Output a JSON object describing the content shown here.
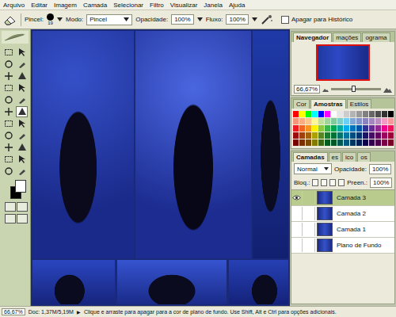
{
  "menu": [
    "Arquivo",
    "Editar",
    "Imagem",
    "Camada",
    "Selecionar",
    "Filtro",
    "Visualizar",
    "Janela",
    "Ajuda"
  ],
  "options": {
    "brush_label": "Pincel:",
    "brush_size": "19",
    "mode_label": "Modo:",
    "mode": "Pincel",
    "opacity_label": "Opacidade:",
    "opacity": "100%",
    "flow_label": "Fluxo:",
    "flow": "100%",
    "history_label": "Apagar para Histórico",
    "history_checked": false
  },
  "tools": [
    {
      "selected": false
    },
    {
      "selected": false
    },
    {
      "selected": false
    },
    {
      "selected": false
    },
    {
      "selected": false
    },
    {
      "selected": false
    },
    {
      "selected": false
    },
    {
      "selected": false
    },
    {
      "selected": false
    },
    {
      "selected": false
    },
    {
      "selected": false
    },
    {
      "selected": true
    },
    {
      "selected": false
    },
    {
      "selected": false
    },
    {
      "selected": false
    },
    {
      "selected": false
    },
    {
      "selected": false
    },
    {
      "selected": false
    },
    {
      "selected": false
    },
    {
      "selected": false
    },
    {
      "selected": false
    },
    {
      "selected": false
    }
  ],
  "colors": {
    "foreground": "#ffffff",
    "background": "#000000"
  },
  "navigator": {
    "tabs": [
      {
        "label": "Navegador",
        "selected": true
      },
      {
        "label": "mações",
        "selected": false
      },
      {
        "label": "ograma",
        "selected": false
      }
    ],
    "zoom": "66,67%",
    "level": 0.45
  },
  "swatches_panel": {
    "tabs": [
      {
        "label": "Cor",
        "selected": false
      },
      {
        "label": "Amostras",
        "selected": true
      },
      {
        "label": "Estilos",
        "selected": false
      }
    ],
    "swatches": [
      "#ff0000",
      "#ffff00",
      "#00ff00",
      "#00ffff",
      "#0000ff",
      "#ff00ff",
      "#ffffff",
      "#e6e6e6",
      "#cccccc",
      "#b3b3b3",
      "#999999",
      "#808080",
      "#666666",
      "#4d4d4d",
      "#333333",
      "#000000",
      "#f7977a",
      "#f9ad81",
      "#fdc68a",
      "#fff79a",
      "#c4df9b",
      "#a2d39c",
      "#82ca9d",
      "#7bcdc8",
      "#6ecff6",
      "#7ea7d8",
      "#8493ca",
      "#8882be",
      "#a187be",
      "#bc8dbf",
      "#f49ac2",
      "#f6989d",
      "#ed1c24",
      "#f26522",
      "#f7941d",
      "#fff200",
      "#8dc73f",
      "#39b54a",
      "#00a651",
      "#00a99d",
      "#00aeef",
      "#0072bc",
      "#0054a6",
      "#2e3192",
      "#662d91",
      "#92278f",
      "#ec008c",
      "#ed145b",
      "#9e0b0f",
      "#a0410d",
      "#a36209",
      "#aba000",
      "#598527",
      "#1a7b30",
      "#007236",
      "#00746b",
      "#0076a3",
      "#004b80",
      "#003471",
      "#1b1464",
      "#440e62",
      "#630460",
      "#9e005d",
      "#9e0039",
      "#790000",
      "#7b2e00",
      "#7d4900",
      "#827b00",
      "#406618",
      "#005e20",
      "#005826",
      "#005952",
      "#005b7f",
      "#003663",
      "#002157",
      "#0d004c",
      "#32004b",
      "#4b0049",
      "#7b0046",
      "#7a0026"
    ]
  },
  "layers_panel": {
    "tabs": [
      {
        "label": "Camadas",
        "selected": true
      },
      {
        "label": "es",
        "selected": false
      },
      {
        "label": "ico",
        "selected": false
      },
      {
        "label": "os",
        "selected": false
      }
    ],
    "blend_mode": "Normal",
    "opacity_label": "Opacidade:",
    "opacity": "100%",
    "lock_label": "Bloq.:",
    "fill_label": "Preen.:",
    "fill": "100%",
    "layers": [
      {
        "name": "Camada 3",
        "selected": true,
        "visible": true
      },
      {
        "name": "Camada 2",
        "selected": false,
        "visible": false
      },
      {
        "name": "Camada 1",
        "selected": false,
        "visible": false
      },
      {
        "name": "Plano de Fundo",
        "selected": false,
        "visible": false
      }
    ]
  },
  "status_bar": {
    "zoom": "66,67%",
    "doc": "Doc: 1,37M/5,19M",
    "arrow": "▶",
    "hint": "Clique e arraste para apagar para a cor de plano de fundo. Use Shift, Alt e Ctrl para opções adicionais."
  }
}
